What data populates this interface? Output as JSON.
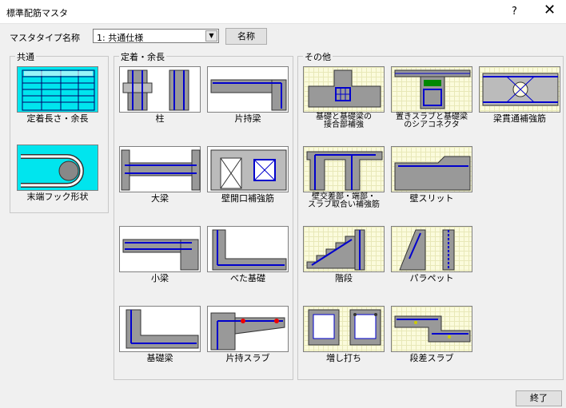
{
  "window": {
    "title": "標準配筋マスタ",
    "help": "?",
    "close": "✕"
  },
  "master_type": {
    "label": "マスタタイプ名称",
    "selected": "1: 共通仕様",
    "name_button": "名称"
  },
  "groups": {
    "common": {
      "label": "共通",
      "items": [
        {
          "label": "定着長さ・余長"
        },
        {
          "label": "末端フック形状"
        }
      ]
    },
    "anchorage": {
      "label": "定着・余長",
      "items": [
        {
          "label": "柱"
        },
        {
          "label": "片持梁"
        },
        {
          "label": "大梁"
        },
        {
          "label": "壁開口補強筋"
        },
        {
          "label": "小梁"
        },
        {
          "label": "べた基礎"
        },
        {
          "label": "基礎梁"
        },
        {
          "label": "片持スラブ"
        }
      ]
    },
    "other": {
      "label": "その他",
      "items": [
        {
          "line1": "基礎と基礎梁の",
          "line2": "接合部補強"
        },
        {
          "line1": "置きスラブと基礎梁",
          "line2": "のシアコネクタ"
        },
        {
          "label": "梁貫通補強筋"
        },
        {
          "line1": "壁交差部・端部・",
          "line2": "スラブ取合い補強筋"
        },
        {
          "label": "壁スリット"
        },
        {
          "label": "階段"
        },
        {
          "label": "パラペット"
        },
        {
          "label": "増し打ち"
        },
        {
          "label": "段差スラブ"
        }
      ]
    }
  },
  "footer": {
    "end_button": "終了"
  }
}
